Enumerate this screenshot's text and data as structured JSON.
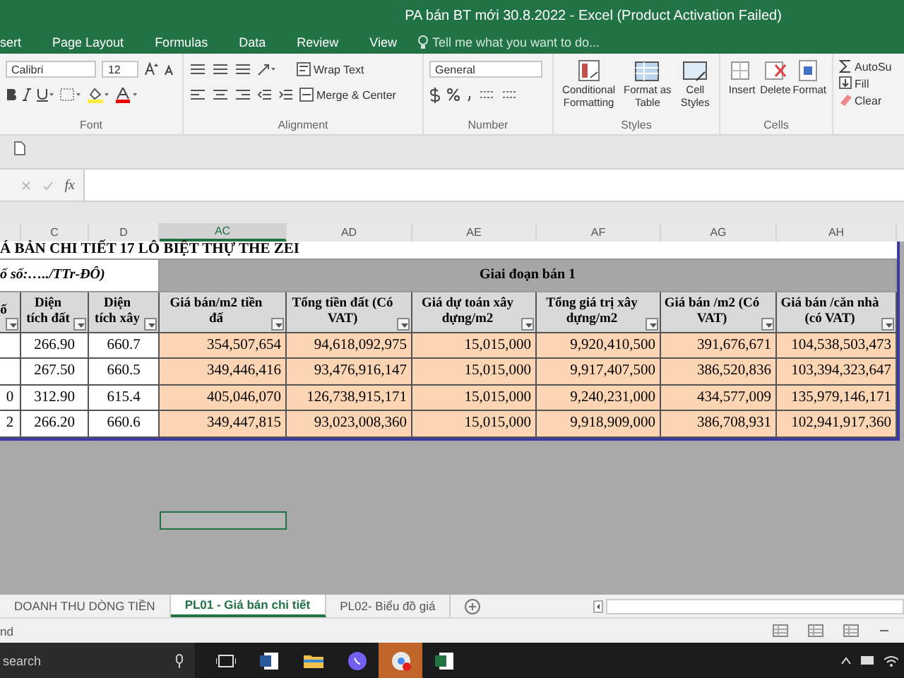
{
  "window": {
    "title": "PA bán BT mới 30.8.2022 - Excel (Product Activation Failed)"
  },
  "ribbon_tabs": [
    {
      "label": "sert"
    },
    {
      "label": "Page Layout"
    },
    {
      "label": "Formulas"
    },
    {
      "label": "Data"
    },
    {
      "label": "Review"
    },
    {
      "label": "View"
    }
  ],
  "tell_me": {
    "placeholder": "Tell me what you want to do..."
  },
  "font_group": {
    "label": "Font",
    "font_name": "Calibri",
    "font_size": "12"
  },
  "alignment_group": {
    "label": "Alignment",
    "buttons": [
      "Wrap Text",
      "Merge & Center"
    ]
  },
  "number_group": {
    "label": "Number",
    "format": "General"
  },
  "styles_group": {
    "label": "Styles",
    "buttons": [
      "Conditional Formatting",
      "Format as Table",
      "Cell Styles"
    ]
  },
  "cells_group": {
    "label": "Cells",
    "buttons": [
      "Insert",
      "Delete",
      "Format"
    ]
  },
  "editing_group": {
    "buttons": [
      "AutoSu",
      "Fill",
      "Clear"
    ]
  },
  "formula_bar": {
    "function_label": "fx"
  },
  "columns": [
    {
      "label": "C",
      "selected": false
    },
    {
      "label": "D",
      "selected": false
    },
    {
      "label": "AC",
      "selected": true
    },
    {
      "label": "AD",
      "selected": false
    },
    {
      "label": "AE",
      "selected": false
    },
    {
      "label": "AF",
      "selected": false
    },
    {
      "label": "AG",
      "selected": false
    },
    {
      "label": "AH",
      "selected": false
    }
  ],
  "sheet": {
    "title": "Á BẢN CHI TIẾT 17 LÔ BIỆT THỰ THE ZEI",
    "subtitle": "ố số:…../TTr-ĐÔ)",
    "phase": "Giai đoạn bán 1",
    "headers": [
      "ố",
      "Diện tích đất",
      "Diện tích xây",
      "Giá bán/m2 tiền đấ",
      "Tổng tiền đất (Có VAT)",
      "Giá dự toán xây dựng/m2",
      "Tổng giá trị xây dựng/m2",
      "Giá bán /m2 (Có VAT)",
      "Giá bán /căn nhà (có VAT)"
    ],
    "rows": [
      {
        "cells": [
          "266.90",
          "660.7",
          "354,507,654",
          "94,618,092,975",
          "15,015,000",
          "9,920,410,500",
          "391,676,671",
          "104,538,503,473"
        ]
      },
      {
        "cells": [
          "267.50",
          "660.5",
          "349,446,416",
          "93,476,916,147",
          "15,015,000",
          "9,917,407,500",
          "386,520,836",
          "103,394,323,647"
        ]
      },
      {
        "column_b": "0",
        "cells": [
          "312.90",
          "615.4",
          "405,046,070",
          "126,738,915,171",
          "15,015,000",
          "9,240,231,000",
          "434,577,009",
          "135,979,146,171"
        ]
      },
      {
        "column_b": "2",
        "cells": [
          "266.20",
          "660.6",
          "349,447,815",
          "93,023,008,360",
          "15,015,000",
          "9,918,909,000",
          "386,708,931",
          "102,941,917,360"
        ]
      }
    ]
  },
  "sheet_tabs": [
    {
      "label": "DOANH THU DÒNG TIỀN",
      "selected": false
    },
    {
      "label": "PL01 - Giá bán chi tiết",
      "selected": true
    },
    {
      "label": "PL02- Biểu đồ giá",
      "selected": false
    }
  ],
  "status_bar": {
    "text": "nd"
  },
  "taskbar": {
    "search_placeholder": "search"
  }
}
